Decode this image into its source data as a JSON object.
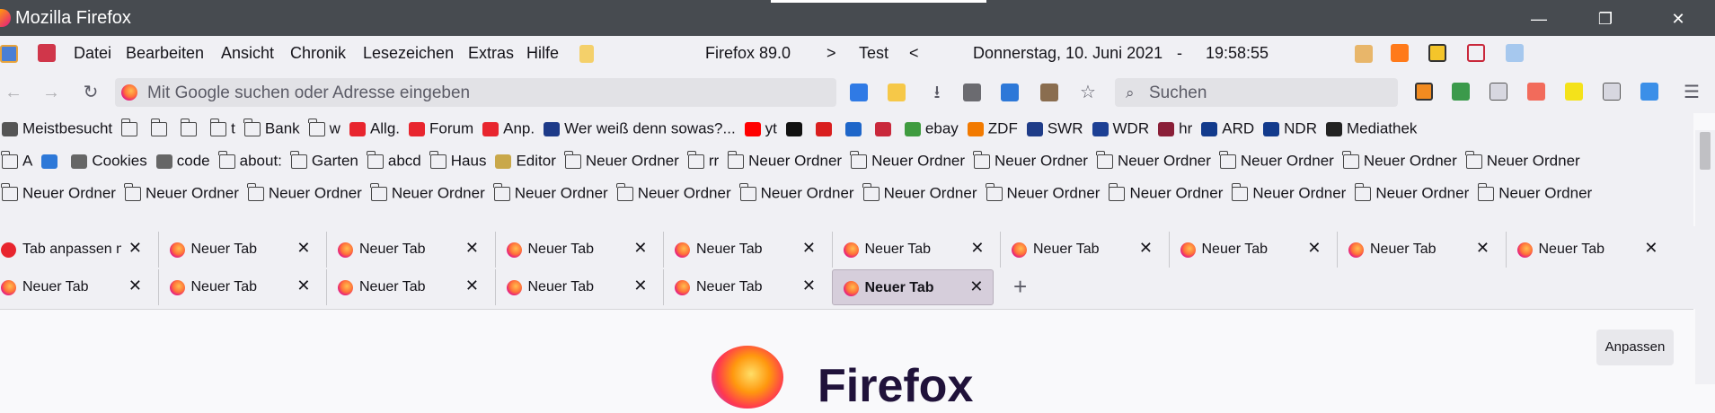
{
  "window": {
    "title": "Mozilla Firefox",
    "controls": [
      "—",
      "❐",
      "✕"
    ]
  },
  "menubar": {
    "items": [
      "Datei",
      "Bearbeiten",
      "Ansicht",
      "Chronik",
      "Lesezeichen",
      "Extras",
      "Hilfe"
    ],
    "version": "Firefox 89.0",
    "separator_left": ">",
    "profile": "Test",
    "separator_right": "<",
    "date": "Donnerstag, 10. Juni 2021",
    "dash": "-",
    "time": "19:58:55"
  },
  "navbar": {
    "back_icon": "←",
    "forward_icon": "→",
    "reload_icon": "↻",
    "url_placeholder": "Mit Google suchen oder Adresse eingeben",
    "search_placeholder": "Suchen",
    "search_icon": "⌕",
    "menu_icon": "☰"
  },
  "bookmarks_row1": [
    {
      "label": "Meistbesucht",
      "icon": "gear-icon"
    },
    {
      "label": "",
      "icon": "folder-icon"
    },
    {
      "label": "",
      "icon": "folder-icon"
    },
    {
      "label": "",
      "icon": "folder-icon"
    },
    {
      "label": "t",
      "icon": "folder-icon"
    },
    {
      "label": "Bank",
      "icon": "folder-icon"
    },
    {
      "label": "w",
      "icon": "folder-icon"
    },
    {
      "label": "Allg.",
      "icon": "flame-icon"
    },
    {
      "label": "Forum",
      "icon": "flame-icon"
    },
    {
      "label": "Anp.",
      "icon": "flame-icon"
    },
    {
      "label": "Wer weiß denn sowas?...",
      "icon": "circle-icon"
    },
    {
      "label": "yt",
      "icon": "youtube-icon"
    },
    {
      "label": "",
      "icon": "github-icon"
    },
    {
      "label": "",
      "icon": "x-icon"
    },
    {
      "label": "",
      "icon": "cb-icon"
    },
    {
      "label": "",
      "icon": "sj-icon"
    },
    {
      "label": "ebay",
      "icon": "bag-icon"
    },
    {
      "label": "ZDF",
      "icon": "zdf-icon"
    },
    {
      "label": "SWR",
      "icon": "swr-icon"
    },
    {
      "label": "WDR",
      "icon": "wdr-icon"
    },
    {
      "label": "hr",
      "icon": "hr-icon"
    },
    {
      "label": "ARD",
      "icon": "ard-icon"
    },
    {
      "label": "NDR",
      "icon": "ndr-icon"
    },
    {
      "label": "Mediathek",
      "icon": "clapper-icon"
    }
  ],
  "bookmarks_row2": [
    {
      "label": "A",
      "icon": "folder-icon"
    },
    {
      "label": "",
      "icon": "table-icon"
    },
    {
      "label": "Cookies",
      "icon": "globe-icon"
    },
    {
      "label": "code",
      "icon": "globe-icon"
    },
    {
      "label": "about:",
      "icon": "folder-icon"
    },
    {
      "label": "Garten",
      "icon": "folder-icon"
    },
    {
      "label": "abcd",
      "icon": "folder-icon"
    },
    {
      "label": "Haus",
      "icon": "folder-icon"
    },
    {
      "label": "Editor",
      "icon": "editor-icon"
    },
    {
      "label": "Neuer Ordner",
      "icon": "folder-icon"
    },
    {
      "label": "rr",
      "icon": "folder-icon"
    },
    {
      "label": "Neuer Ordner",
      "icon": "folder-icon"
    },
    {
      "label": "Neuer Ordner",
      "icon": "folder-icon"
    },
    {
      "label": "Neuer Ordner",
      "icon": "folder-icon"
    },
    {
      "label": "Neuer Ordner",
      "icon": "folder-icon"
    },
    {
      "label": "Neuer Ordner",
      "icon": "folder-icon"
    },
    {
      "label": "Neuer Ordner",
      "icon": "folder-icon"
    },
    {
      "label": "Neuer Ordner",
      "icon": "folder-icon"
    }
  ],
  "bookmarks_row3": [
    {
      "label": "Neuer Ordner",
      "icon": "folder-icon"
    },
    {
      "label": "Neuer Ordner",
      "icon": "folder-icon"
    },
    {
      "label": "Neuer Ordner",
      "icon": "folder-icon"
    },
    {
      "label": "Neuer Ordner",
      "icon": "folder-icon"
    },
    {
      "label": "Neuer Ordner",
      "icon": "folder-icon"
    },
    {
      "label": "Neuer Ordner",
      "icon": "folder-icon"
    },
    {
      "label": "Neuer Ordner",
      "icon": "folder-icon"
    },
    {
      "label": "Neuer Ordner",
      "icon": "folder-icon"
    },
    {
      "label": "Neuer Ordner",
      "icon": "folder-icon"
    },
    {
      "label": "Neuer Ordner",
      "icon": "folder-icon"
    },
    {
      "label": "Neuer Ordner",
      "icon": "folder-icon"
    },
    {
      "label": "Neuer Ordner",
      "icon": "folder-icon"
    },
    {
      "label": "Neuer Ordner",
      "icon": "folder-icon"
    }
  ],
  "tabs_row1": [
    {
      "label": "Tab anpassen mit",
      "icon": "flame-icon"
    },
    {
      "label": "Neuer Tab",
      "icon": "firefox-icon"
    },
    {
      "label": "Neuer Tab",
      "icon": "firefox-icon"
    },
    {
      "label": "Neuer Tab",
      "icon": "firefox-icon"
    },
    {
      "label": "Neuer Tab",
      "icon": "firefox-icon"
    },
    {
      "label": "Neuer Tab",
      "icon": "firefox-icon"
    },
    {
      "label": "Neuer Tab",
      "icon": "firefox-icon"
    },
    {
      "label": "Neuer Tab",
      "icon": "firefox-icon"
    },
    {
      "label": "Neuer Tab",
      "icon": "firefox-icon"
    },
    {
      "label": "Neuer Tab",
      "icon": "firefox-icon"
    }
  ],
  "tabs_row2": [
    {
      "label": "Neuer Tab",
      "active": false
    },
    {
      "label": "Neuer Tab",
      "active": false
    },
    {
      "label": "Neuer Tab",
      "active": false
    },
    {
      "label": "Neuer Tab",
      "active": false
    },
    {
      "label": "Neuer Tab",
      "active": false
    },
    {
      "label": "Neuer Tab",
      "active": true
    }
  ],
  "tab_close": "✕",
  "new_tab": "+",
  "content": {
    "customize_label": "Anpassen",
    "logo_text": "Firefox"
  },
  "colors": {
    "titlebar": "#474b50",
    "toolbar": "#f0f0f4",
    "active_tab": "#d6cedb"
  }
}
